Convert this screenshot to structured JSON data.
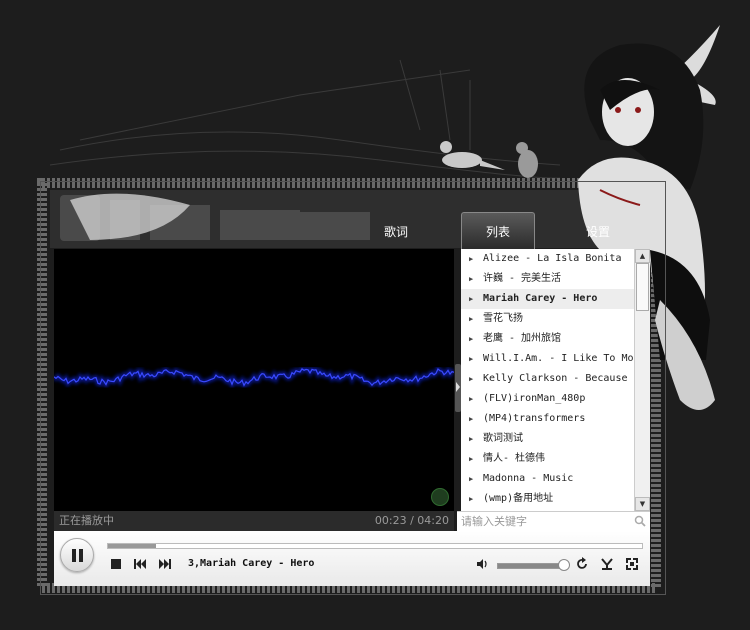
{
  "tabs": {
    "lyrics": "歌词",
    "list": "列表",
    "settings": "设置"
  },
  "status": {
    "text": "正在播放中",
    "time": "00:23 / 04:20"
  },
  "playlist": [
    {
      "label": "Alizee - La Isla Bonita",
      "active": false
    },
    {
      "label": "许巍 - 完美生活",
      "active": false
    },
    {
      "label": "Mariah Carey - Hero",
      "active": true
    },
    {
      "label": "雪花飞扬",
      "active": false
    },
    {
      "label": "老鹰 - 加州旅馆",
      "active": false
    },
    {
      "label": "Will.I.Am. - I Like To Move It",
      "active": false
    },
    {
      "label": "Kelly Clarkson - Because of You",
      "active": false
    },
    {
      "label": "(FLV)ironMan_480p",
      "active": false
    },
    {
      "label": "(MP4)transformers",
      "active": false
    },
    {
      "label": "歌词测试",
      "active": false
    },
    {
      "label": "情人- 杜德伟",
      "active": false
    },
    {
      "label": "Madonna - Music",
      "active": false
    },
    {
      "label": "(wmp)备用地址",
      "active": false
    }
  ],
  "search": {
    "placeholder": "请输入关键字"
  },
  "player": {
    "now_playing": "3,Mariah Carey - Hero",
    "progress": 0.09,
    "volume": 0.95,
    "state": "playing"
  },
  "icons": {
    "pause": "pause-icon",
    "stop": "stop-icon",
    "prev": "previous-icon",
    "next": "next-icon",
    "volume": "volume-icon",
    "repeat": "repeat-icon",
    "eq": "equalizer-icon",
    "fullscreen": "fullscreen-icon",
    "search": "search-icon"
  },
  "colors": {
    "waveform": "#2233ff",
    "background": "#1d1d1d",
    "visualizer": "#000000"
  }
}
